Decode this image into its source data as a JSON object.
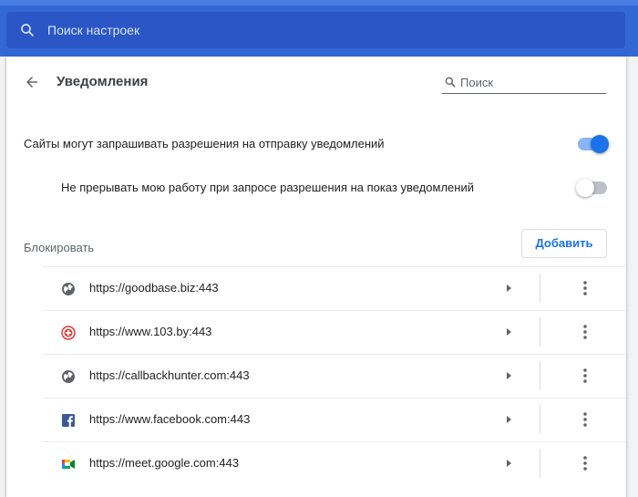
{
  "search": {
    "placeholder": "Поиск настроек",
    "icon": "search-icon"
  },
  "header": {
    "back_icon": "arrow-back-icon",
    "title": "Уведомления",
    "search_placeholder": "Поиск"
  },
  "settings": {
    "ask_permission": {
      "label": "Сайты могут запрашивать разрешения на отправку уведомлений",
      "enabled": true
    },
    "quiet_messaging": {
      "label": "Не прерывать мою работу при запросе разрешения на показ уведомлений",
      "enabled": false
    }
  },
  "block": {
    "label": "Блокировать",
    "add_label": "Добавить",
    "sites": [
      {
        "url": "https://goodbase.biz:443",
        "icon": "globe-icon"
      },
      {
        "url": "https://www.103.by:443",
        "icon": "red-plus-icon"
      },
      {
        "url": "https://callbackhunter.com:443",
        "icon": "globe-icon"
      },
      {
        "url": "https://www.facebook.com:443",
        "icon": "facebook-icon"
      },
      {
        "url": "https://meet.google.com:443",
        "icon": "google-meet-icon"
      }
    ]
  },
  "colors": {
    "accent": "#1a73e8",
    "topbar": "#3367d6",
    "search_bg": "#2a56c6"
  }
}
